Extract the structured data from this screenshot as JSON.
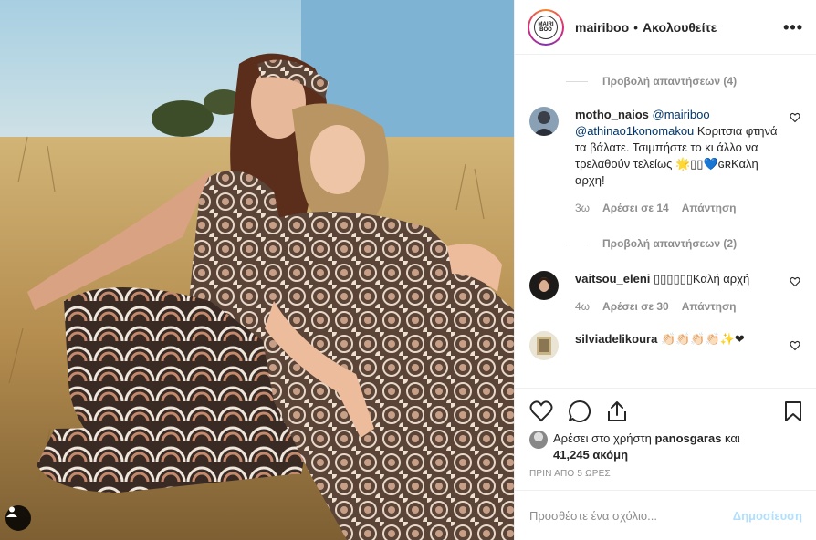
{
  "post": {
    "username": "mairiboo",
    "separator": "•",
    "follow_label": "Ακολουθείτε",
    "more_label": "•••",
    "avatar_logo_text": "MAIRI BOO"
  },
  "comments": {
    "view_replies_1": "Προβολή απαντήσεων (4)",
    "view_replies_2": "Προβολή απαντήσεων (2)",
    "items": [
      {
        "user": "motho_naios",
        "mention1": "@mairiboo",
        "mention2": "@athinao1konomakou",
        "text": " Κοριτσια φτηνά τα βάλατε. Τσιμπήστε το κι άλλο να τρελαθούν τελείως 🌟▯▯💙ɢʀΚαλη αρχη!",
        "time": "3ω",
        "likes": "Αρέσει σε 14",
        "reply": "Απάντηση"
      },
      {
        "user": "vaitsou_eleni",
        "text": " ▯▯▯▯▯▯Καλή αρχή",
        "time": "4ω",
        "likes": "Αρέσει σε 30",
        "reply": "Απάντηση"
      },
      {
        "user": "silviadelikoura",
        "text": " 👏🏻👏🏻👏🏻👏🏻✨❤"
      }
    ]
  },
  "likes": {
    "prefix": "Αρέσει στο χρήστη ",
    "user": "panosgaras",
    "middle": " και",
    "count": "41,245 ακόμη",
    "time_ago": "ΠΡΙΝ ΑΠΟ 5 ΩΡΕΣ"
  },
  "add_comment": {
    "placeholder": "Προσθέστε ένα σχόλιο...",
    "post_label": "Δημοσίευση"
  },
  "icons": [
    "heart-icon",
    "comment-icon",
    "share-icon",
    "bookmark-icon",
    "user-tag-icon",
    "more-icon"
  ]
}
